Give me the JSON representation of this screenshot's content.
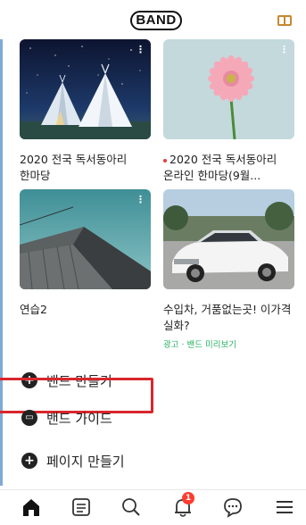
{
  "header": {
    "logo": "BAND",
    "guide_icon": "book-icon"
  },
  "cards": [
    {
      "title": "2020 전국 독서동아리 한마당",
      "has_dot": false,
      "image": "teepee-night-photo",
      "more": "⋮"
    },
    {
      "title": "2020 전국 독서동아리 온라인 한마당(9월...",
      "has_dot": true,
      "image": "pink-gerbera-photo",
      "more": "⋮"
    },
    {
      "title": "연습2",
      "has_dot": false,
      "image": "barn-roof-photo",
      "more": "⋮"
    },
    {
      "title": "수입차, 거품없는곳! 이가격 실화?",
      "has_dot": false,
      "image": "white-sedan-photo",
      "ad_label": "광고 · 밴드 미리보기"
    }
  ],
  "menu": [
    {
      "label": "밴드 만들기",
      "icon": "plus-circle-icon",
      "glyph": "+"
    },
    {
      "label": "밴드 가이드",
      "icon": "book-circle-icon",
      "glyph": "▭"
    },
    {
      "label": "페이지 만들기",
      "icon": "plus-circle-icon",
      "glyph": "+"
    }
  ],
  "bottom_nav": {
    "items": [
      "home-icon",
      "newsfeed-icon",
      "search-icon",
      "notification-icon",
      "chat-icon",
      "menu-icon"
    ],
    "notification_count": "1"
  },
  "colors": {
    "highlight": "#d8262c",
    "ad_text": "#27b163",
    "badge": "#ff3b30",
    "guide_icon": "#c7882f"
  }
}
